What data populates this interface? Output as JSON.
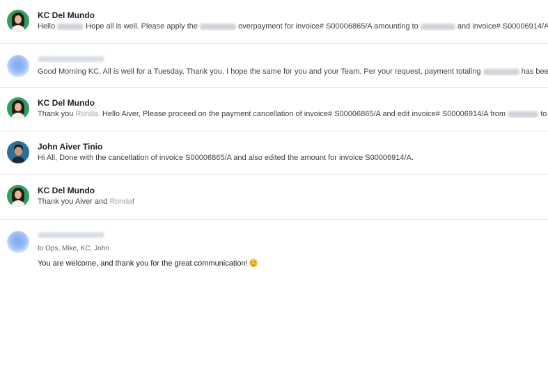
{
  "messages": [
    {
      "sender": "KC Del Mundo",
      "snippet_parts": [
        "Hello ",
        " Hope all is well. Please apply the ",
        " overpayment for invoice# S00006865/A amounting to ",
        " and invoice# S00006914/A"
      ],
      "avatar": "kc-avatar"
    },
    {
      "sender": "",
      "snippet_parts": [
        "Good Morning KC, All is well for a Tuesday, Thank you. I hope the same for you and your Team. Per your request, payment totaling ",
        " has been applied to"
      ],
      "avatar": "blurred-avatar"
    },
    {
      "sender": "KC Del Mundo",
      "snippet_parts": [
        "Thank you ",
        " Hello Aiver, Please proceed on the payment cancellation of invoice# S00006865/A and edit invoice# S00006914/A from ",
        " to "
      ],
      "redacted_name": "Ronda:",
      "avatar": "kc-avatar"
    },
    {
      "sender": "John Aiver Tinio",
      "snippet": "Hi All, Done with the cancellation of invoice S00006865/A and also edited the amount for invoice S00006914/A.",
      "avatar": "john-avatar"
    },
    {
      "sender": "KC Del Mundo",
      "snippet_parts": [
        "Thank you Aiver and ",
        "!"
      ],
      "redacted_name": "Ronda",
      "avatar": "kc-avatar"
    },
    {
      "sender": "",
      "to_line": "to Ops, Mike, KC, John",
      "body": "You are welcome, and thank you for the great communication!",
      "emoji": "smiling-face",
      "avatar": "blurred-avatar"
    }
  ]
}
